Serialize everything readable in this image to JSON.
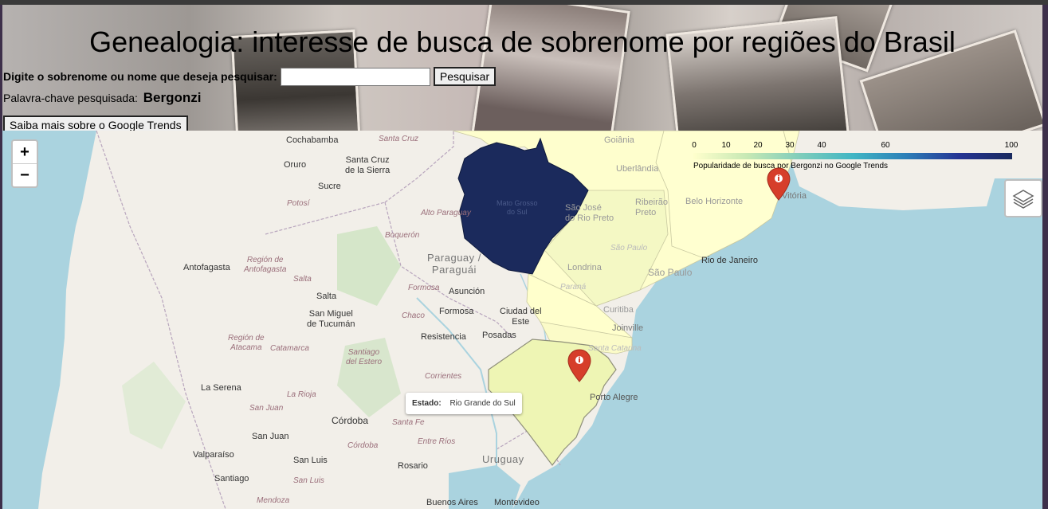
{
  "header": {
    "title": "Genealogia: interesse de busca de sobrenome por regiões do Brasil",
    "search_label": "Digite o sobrenome ou nome que deseja pesquisar:",
    "search_value": "",
    "search_button": "Pesquisar",
    "keyword_label": "Palavra-chave pesquisada:",
    "keyword_value": "Bergonzi",
    "learn_more_button": "Saiba mais sobre o Google Trends"
  },
  "map": {
    "zoom_in": "+",
    "zoom_out": "−",
    "layers_icon": "layers-icon",
    "marker_icon": "info-marker-icon",
    "legend": {
      "ticks": [
        "0",
        "10",
        "20",
        "30",
        "40",
        "60",
        "100"
      ],
      "caption": "Popularidade de busca por Bergonzi no Google Trends",
      "colors": [
        "#ffffcc",
        "#c7e9b4",
        "#7fcdbb",
        "#41b6c4",
        "#2c7fb8",
        "#253494",
        "#1a2a5e"
      ]
    },
    "tooltip": {
      "key": "Estado:",
      "value": "Rio Grande do Sul"
    },
    "choropleth_colors": {
      "mato_grosso_do_sul": "#1b2a5c",
      "low": "#ffffcc",
      "medium_low": "#f4f8c4",
      "rio_grande_do_sul": "#eef5b4"
    },
    "labels": {
      "cochabamba": "Cochabamba",
      "santa_cruz": "Santa Cruz",
      "oruro": "Oruro",
      "santa_cruz_sierra": "Santa Cruz\nde la Sierra",
      "sucre": "Sucre",
      "potosi": "Potosí",
      "alto_paraguay": "Alto Paraguay",
      "boqueron": "Boquerón",
      "antofagasta": "Antofagasta",
      "region_antofagasta": "Región de\nAntofagasta",
      "salta_reg": "Salta",
      "salta": "Salta",
      "paraguay": "Paraguay /\nParaguái",
      "formosa_reg": "Formosa",
      "asuncion": "Asunción",
      "formosa": "Formosa",
      "chaco": "Chaco",
      "ciudad_del_este": "Ciudad del\nEste",
      "tucuman": "San Miguel\nde Tucumán",
      "resistencia": "Resistencia",
      "posadas": "Posadas",
      "region_atacama": "Región de\nAtacama",
      "catamarca": "Catamarca",
      "santiago_estero": "Santiago\ndel Estero",
      "corrientes": "Corrientes",
      "la_serena": "La Serena",
      "la_rioja": "La Rioja",
      "san_juan_reg": "San Juan",
      "cordoba": "Córdoba",
      "santa_fe": "Santa Fe",
      "cordoba_reg": "Córdoba",
      "entre_rios": "Entre Ríos",
      "san_juan": "San Juan",
      "valparaiso": "Valparaíso",
      "santiago": "Santiago",
      "san_luis": "San Luis",
      "san_luis_reg": "San Luis",
      "rosario": "Rosario",
      "uruguay": "Uruguay",
      "mendoza": "Mendoza",
      "buenos_aires": "Buenos Aires",
      "montevideo": "Montevideo",
      "goiania": "Goiânia",
      "uberlandia": "Uberlândia",
      "sao_jose": "São José\ndo Rio Preto",
      "ribeirao_preto": "Ribeirão\nPreto",
      "belo_horizonte": "Belo Horizonte",
      "vitoria": "Vitória",
      "londrina": "Londrina",
      "parana": "Paraná",
      "sao_paulo_reg": "São Paulo",
      "rio_de_janeiro": "Rio de Janeiro",
      "sao_paulo": "São Paulo",
      "curitiba": "Curitiba",
      "joinville": "Joinville",
      "santa_catarina": "Santa Catarina",
      "porto_alegre": "Porto Alegre",
      "mato_grosso_do_sul": "Mato Grosso\ndo Sul"
    }
  }
}
